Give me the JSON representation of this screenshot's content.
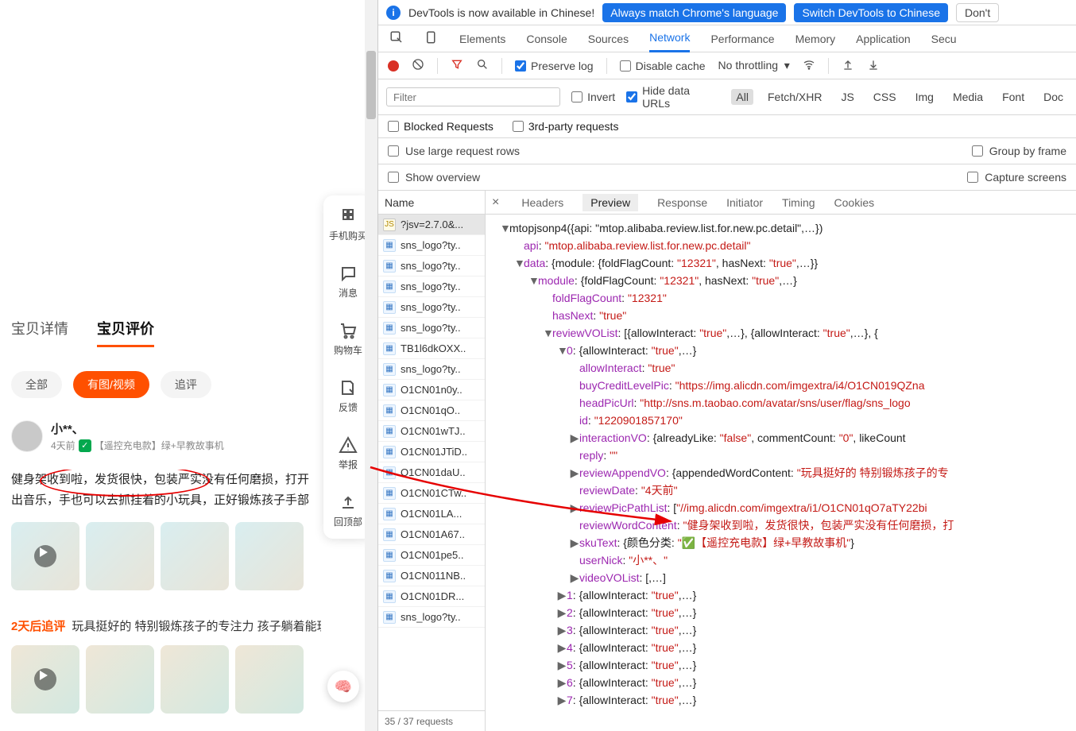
{
  "page": {
    "rail": {
      "items": [
        {
          "name": "mobile-buy",
          "label": "手机购买"
        },
        {
          "name": "messages",
          "label": "消息"
        },
        {
          "name": "cart",
          "label": "购物车"
        },
        {
          "name": "feedback",
          "label": "反馈"
        },
        {
          "name": "report",
          "label": "举报"
        },
        {
          "name": "back-top",
          "label": "回顶部"
        }
      ]
    },
    "tabs": {
      "detail": "宝贝详情",
      "reviews": "宝贝评价"
    },
    "filters": {
      "all": "全部",
      "media": "有图/视频",
      "append": "追评"
    },
    "review": {
      "nick": "小**、",
      "date": "4天前",
      "sku": "【遥控充电款】绿+早教故事机",
      "line1": "健身架收到啦，发货很快，包装严实没有任何磨损，打开",
      "line2": "出音乐，手也可以去抓挂着的小玩具，正好锻炼孩子手部"
    },
    "append": {
      "tag": "2天后追评",
      "text": "玩具挺好的 特别锻炼孩子的专注力 孩子躺着能玩很"
    }
  },
  "devtools": {
    "infobar": {
      "msg": "DevTools is now available in Chinese!",
      "btn1": "Always match Chrome's language",
      "btn2": "Switch DevTools to Chinese",
      "btn3": "Don't"
    },
    "mainTabs": [
      "Elements",
      "Console",
      "Sources",
      "Network",
      "Performance",
      "Memory",
      "Application",
      "Secu"
    ],
    "mainActive": "Network",
    "toolbar": {
      "preserve": "Preserve log",
      "disable": "Disable cache",
      "throttle": "No throttling"
    },
    "filter": {
      "placeholder": "Filter",
      "invert": "Invert",
      "hide": "Hide data URLs",
      "types": [
        "All",
        "Fetch/XHR",
        "JS",
        "CSS",
        "Img",
        "Media",
        "Font",
        "Doc"
      ],
      "blocked": "Blocked Requests",
      "thirdparty": "3rd-party requests"
    },
    "opts": {
      "large": "Use large request rows",
      "overview": "Show overview",
      "group": "Group by frame",
      "capture": "Capture screens"
    },
    "requests": {
      "head": "Name",
      "items": [
        {
          "n": "?jsv=2.7.0&...",
          "t": "js",
          "sel": true
        },
        {
          "n": "sns_logo?ty..",
          "t": "img"
        },
        {
          "n": "sns_logo?ty..",
          "t": "img"
        },
        {
          "n": "sns_logo?ty..",
          "t": "img"
        },
        {
          "n": "sns_logo?ty..",
          "t": "img"
        },
        {
          "n": "sns_logo?ty..",
          "t": "img"
        },
        {
          "n": "TB1l6dkOXX..",
          "t": "img"
        },
        {
          "n": "sns_logo?ty..",
          "t": "img"
        },
        {
          "n": "O1CN01n0y..",
          "t": "img"
        },
        {
          "n": "O1CN01qO..",
          "t": "img"
        },
        {
          "n": "O1CN01wTJ..",
          "t": "img"
        },
        {
          "n": "O1CN01JTiD..",
          "t": "img"
        },
        {
          "n": "O1CN01daU..",
          "t": "img"
        },
        {
          "n": "O1CN01CTw..",
          "t": "img"
        },
        {
          "n": "O1CN01LA...",
          "t": "img"
        },
        {
          "n": "O1CN01A67..",
          "t": "img"
        },
        {
          "n": "O1CN01pe5..",
          "t": "img"
        },
        {
          "n": "O1CN011NB..",
          "t": "img"
        },
        {
          "n": "O1CN01DR...",
          "t": "img"
        },
        {
          "n": "sns_logo?ty..",
          "t": "img"
        }
      ],
      "footer": "35 / 37 requests"
    },
    "detailTabs": [
      "Headers",
      "Preview",
      "Response",
      "Initiator",
      "Timing",
      "Cookies"
    ],
    "detailActive": "Preview",
    "preview": {
      "root": "mtopjsonp4({api: \"mtop.alibaba.review.list.for.new.pc.detail\",…})",
      "api": {
        "k": "api",
        "v": "\"mtop.alibaba.review.list.for.new.pc.detail\""
      },
      "data": "data: {module: {foldFlagCount: \"12321\", hasNext: \"true\",…}}",
      "module": "module: {foldFlagCount: \"12321\", hasNext: \"true\",…}",
      "foldFlagCount": {
        "k": "foldFlagCount",
        "v": "\"12321\""
      },
      "hasNext": {
        "k": "hasNext",
        "v": "\"true\""
      },
      "reviewVOList": "reviewVOList: [{allowInteract: \"true\",…}, {allowInteract: \"true\",…}, {",
      "idx0": "0: {allowInteract: \"true\",…}",
      "allowInteract": {
        "k": "allowInteract",
        "v": "\"true\""
      },
      "buyCredit": {
        "k": "buyCreditLevelPic",
        "v": "\"https://img.alicdn.com/imgextra/i4/O1CN019QZna"
      },
      "headPic": {
        "k": "headPicUrl",
        "v": "\"http://sns.m.taobao.com/avatar/sns/user/flag/sns_logo"
      },
      "id": {
        "k": "id",
        "v": "\"1220901857170\""
      },
      "interaction": "interactionVO: {alreadyLike: \"false\", commentCount: \"0\", likeCount",
      "reply": {
        "k": "reply",
        "v": "\"\""
      },
      "append": "reviewAppendVO: {appendedWordContent: \"玩具挺好的 特别锻炼孩子的专",
      "reviewDate": {
        "k": "reviewDate",
        "v": "\"4天前\""
      },
      "picPath": "reviewPicPathList: [\"//img.alicdn.com/imgextra/i1/O1CN01qO7aTY22bi",
      "wordContent": {
        "k": "reviewWordContent",
        "v": "\"健身架收到啦，发货很快，包装严实没有任何磨损，打"
      },
      "skuText": "skuText: {颜色分类: \"✅【遥控充电款】绿+早教故事机\"}",
      "userNick": {
        "k": "userNick",
        "v": "\"小**、\""
      },
      "videoVOList": "videoVOList: [,…]",
      "rest": [
        "1: {allowInteract: \"true\",…}",
        "2: {allowInteract: \"true\",…}",
        "3: {allowInteract: \"true\",…}",
        "4: {allowInteract: \"true\",…}",
        "5: {allowInteract: \"true\",…}",
        "6: {allowInteract: \"true\",…}",
        "7: {allowInteract: \"true\" …}"
      ]
    }
  }
}
